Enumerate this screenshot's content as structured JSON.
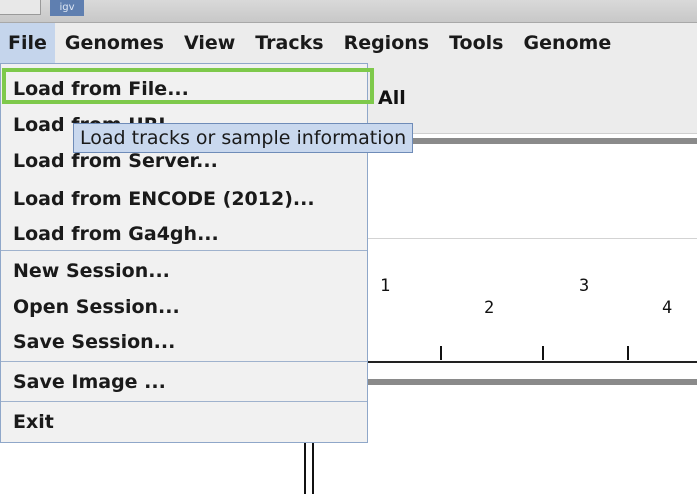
{
  "window": {
    "app_name": "igv"
  },
  "menubar": {
    "items": [
      "File",
      "Genomes",
      "View",
      "Tracks",
      "Regions",
      "Tools",
      "Genome"
    ]
  },
  "file_menu": {
    "items": [
      "Load from File...",
      "Load from URL...",
      "Load from Server...",
      "Load from ENCODE (2012)...",
      "Load from Ga4gh...",
      "New Session...",
      "Open Session...",
      "Save Session...",
      "Save Image ...",
      "Exit"
    ]
  },
  "tooltip": {
    "text": "Load tracks or sample information"
  },
  "locus": {
    "label": "All"
  },
  "ruler": {
    "labels": [
      "1",
      "2",
      "3",
      "4"
    ]
  },
  "colors": {
    "highlight": "#7ec94b",
    "menu_active": "#c5d5ec",
    "tooltip_bg": "#c9d8ee"
  }
}
